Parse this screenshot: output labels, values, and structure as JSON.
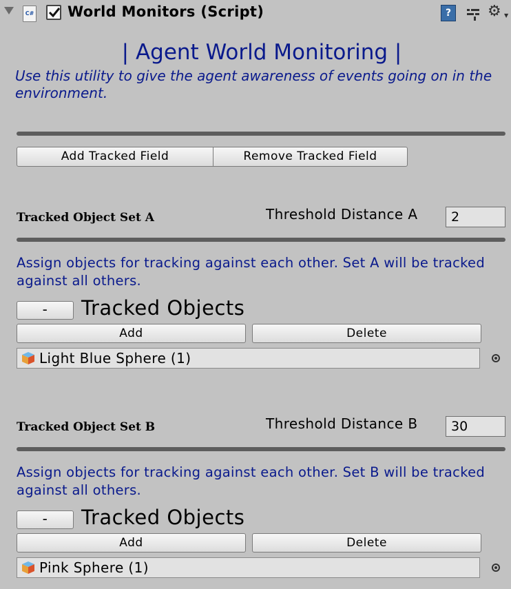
{
  "header": {
    "title": "World Monitors (Script)",
    "script_icon_text": "C#",
    "enabled": true,
    "help_icon_text": "?",
    "icons": [
      "foldout-arrow-icon",
      "script-icon",
      "help-icon",
      "preset-icon",
      "gear-icon"
    ]
  },
  "main_title": "| Agent World Monitoring |",
  "blurb": "Use this utility to give the agent awareness of events going on in the environment.",
  "buttons": {
    "add_field": "Add Tracked Field",
    "remove_field": "Remove Tracked Field"
  },
  "set_a": {
    "title": "Tracked Object Set A",
    "threshold_label": "Threshold Distance A",
    "threshold_value": "2",
    "description": "Assign objects for tracking against each other. Set A will be tracked against all others.",
    "collapse_label": "-",
    "list_label": "Tracked Objects",
    "add_label": "Add",
    "delete_label": "Delete",
    "objects": [
      "Light Blue Sphere (1)"
    ]
  },
  "set_b": {
    "title": "Tracked Object Set B",
    "threshold_label": "Threshold Distance B",
    "threshold_value": "30",
    "description": "Assign objects for tracking against each other. Set B will be tracked against all others.",
    "collapse_label": "-",
    "list_label": "Tracked Objects",
    "add_label": "Add",
    "delete_label": "Delete",
    "objects": [
      "Pink Sphere (1)"
    ]
  },
  "colors": {
    "panel_bg": "#c2c2c2",
    "accent_text": "#0a1a8c",
    "separator": "#5d5d5d"
  }
}
